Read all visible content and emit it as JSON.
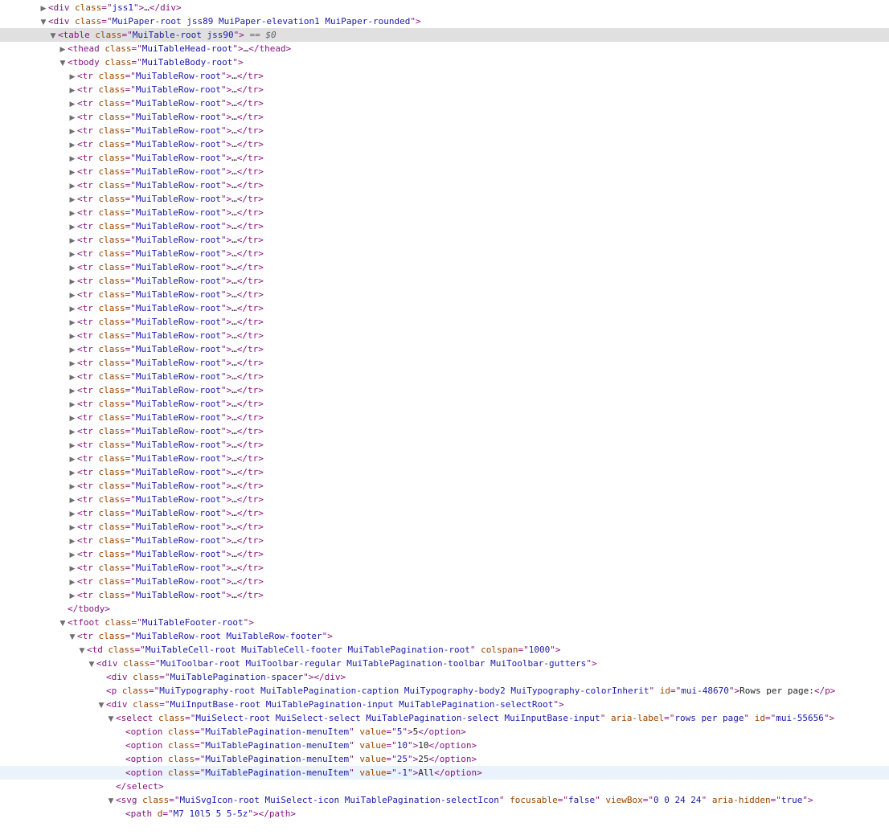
{
  "selected_marker": "== $0",
  "nodes": [
    {
      "depth": 0,
      "kind": "collapsed",
      "tag": "div",
      "attrs": [
        [
          "class",
          "jss1"
        ]
      ],
      "content": "…",
      "close": true
    },
    {
      "depth": 0,
      "kind": "expanded",
      "tag": "div",
      "attrs": [
        [
          "class",
          "MuiPaper-root jss89 MuiPaper-elevation1 MuiPaper-rounded"
        ]
      ]
    },
    {
      "depth": 1,
      "kind": "expanded",
      "tag": "table",
      "attrs": [
        [
          "class",
          "MuiTable-root jss90"
        ]
      ],
      "selected": true
    },
    {
      "depth": 2,
      "kind": "collapsed",
      "tag": "thead",
      "attrs": [
        [
          "class",
          "MuiTableHead-root"
        ]
      ],
      "content": "…",
      "close": true
    },
    {
      "depth": 2,
      "kind": "expanded",
      "tag": "tbody",
      "attrs": [
        [
          "class",
          "MuiTableBody-root"
        ]
      ]
    },
    {
      "depth": 3,
      "kind": "collapsed",
      "tag": "tr",
      "attrs": [
        [
          "class",
          "MuiTableRow-root"
        ]
      ],
      "content": "…",
      "close": true
    },
    {
      "depth": 3,
      "kind": "collapsed",
      "tag": "tr",
      "attrs": [
        [
          "class",
          "MuiTableRow-root"
        ]
      ],
      "content": "…",
      "close": true
    },
    {
      "depth": 3,
      "kind": "collapsed",
      "tag": "tr",
      "attrs": [
        [
          "class",
          "MuiTableRow-root"
        ]
      ],
      "content": "…",
      "close": true
    },
    {
      "depth": 3,
      "kind": "collapsed",
      "tag": "tr",
      "attrs": [
        [
          "class",
          "MuiTableRow-root"
        ]
      ],
      "content": "…",
      "close": true
    },
    {
      "depth": 3,
      "kind": "collapsed",
      "tag": "tr",
      "attrs": [
        [
          "class",
          "MuiTableRow-root"
        ]
      ],
      "content": "…",
      "close": true
    },
    {
      "depth": 3,
      "kind": "collapsed",
      "tag": "tr",
      "attrs": [
        [
          "class",
          "MuiTableRow-root"
        ]
      ],
      "content": "…",
      "close": true
    },
    {
      "depth": 3,
      "kind": "collapsed",
      "tag": "tr",
      "attrs": [
        [
          "class",
          "MuiTableRow-root"
        ]
      ],
      "content": "…",
      "close": true
    },
    {
      "depth": 3,
      "kind": "collapsed",
      "tag": "tr",
      "attrs": [
        [
          "class",
          "MuiTableRow-root"
        ]
      ],
      "content": "…",
      "close": true
    },
    {
      "depth": 3,
      "kind": "collapsed",
      "tag": "tr",
      "attrs": [
        [
          "class",
          "MuiTableRow-root"
        ]
      ],
      "content": "…",
      "close": true
    },
    {
      "depth": 3,
      "kind": "collapsed",
      "tag": "tr",
      "attrs": [
        [
          "class",
          "MuiTableRow-root"
        ]
      ],
      "content": "…",
      "close": true
    },
    {
      "depth": 3,
      "kind": "collapsed",
      "tag": "tr",
      "attrs": [
        [
          "class",
          "MuiTableRow-root"
        ]
      ],
      "content": "…",
      "close": true
    },
    {
      "depth": 3,
      "kind": "collapsed",
      "tag": "tr",
      "attrs": [
        [
          "class",
          "MuiTableRow-root"
        ]
      ],
      "content": "…",
      "close": true
    },
    {
      "depth": 3,
      "kind": "collapsed",
      "tag": "tr",
      "attrs": [
        [
          "class",
          "MuiTableRow-root"
        ]
      ],
      "content": "…",
      "close": true
    },
    {
      "depth": 3,
      "kind": "collapsed",
      "tag": "tr",
      "attrs": [
        [
          "class",
          "MuiTableRow-root"
        ]
      ],
      "content": "…",
      "close": true
    },
    {
      "depth": 3,
      "kind": "collapsed",
      "tag": "tr",
      "attrs": [
        [
          "class",
          "MuiTableRow-root"
        ]
      ],
      "content": "…",
      "close": true
    },
    {
      "depth": 3,
      "kind": "collapsed",
      "tag": "tr",
      "attrs": [
        [
          "class",
          "MuiTableRow-root"
        ]
      ],
      "content": "…",
      "close": true
    },
    {
      "depth": 3,
      "kind": "collapsed",
      "tag": "tr",
      "attrs": [
        [
          "class",
          "MuiTableRow-root"
        ]
      ],
      "content": "…",
      "close": true
    },
    {
      "depth": 3,
      "kind": "collapsed",
      "tag": "tr",
      "attrs": [
        [
          "class",
          "MuiTableRow-root"
        ]
      ],
      "content": "…",
      "close": true
    },
    {
      "depth": 3,
      "kind": "collapsed",
      "tag": "tr",
      "attrs": [
        [
          "class",
          "MuiTableRow-root"
        ]
      ],
      "content": "…",
      "close": true
    },
    {
      "depth": 3,
      "kind": "collapsed",
      "tag": "tr",
      "attrs": [
        [
          "class",
          "MuiTableRow-root"
        ]
      ],
      "content": "…",
      "close": true
    },
    {
      "depth": 3,
      "kind": "collapsed",
      "tag": "tr",
      "attrs": [
        [
          "class",
          "MuiTableRow-root"
        ]
      ],
      "content": "…",
      "close": true
    },
    {
      "depth": 3,
      "kind": "collapsed",
      "tag": "tr",
      "attrs": [
        [
          "class",
          "MuiTableRow-root"
        ]
      ],
      "content": "…",
      "close": true
    },
    {
      "depth": 3,
      "kind": "collapsed",
      "tag": "tr",
      "attrs": [
        [
          "class",
          "MuiTableRow-root"
        ]
      ],
      "content": "…",
      "close": true
    },
    {
      "depth": 3,
      "kind": "collapsed",
      "tag": "tr",
      "attrs": [
        [
          "class",
          "MuiTableRow-root"
        ]
      ],
      "content": "…",
      "close": true
    },
    {
      "depth": 3,
      "kind": "collapsed",
      "tag": "tr",
      "attrs": [
        [
          "class",
          "MuiTableRow-root"
        ]
      ],
      "content": "…",
      "close": true
    },
    {
      "depth": 3,
      "kind": "collapsed",
      "tag": "tr",
      "attrs": [
        [
          "class",
          "MuiTableRow-root"
        ]
      ],
      "content": "…",
      "close": true
    },
    {
      "depth": 3,
      "kind": "collapsed",
      "tag": "tr",
      "attrs": [
        [
          "class",
          "MuiTableRow-root"
        ]
      ],
      "content": "…",
      "close": true
    },
    {
      "depth": 3,
      "kind": "collapsed",
      "tag": "tr",
      "attrs": [
        [
          "class",
          "MuiTableRow-root"
        ]
      ],
      "content": "…",
      "close": true
    },
    {
      "depth": 3,
      "kind": "collapsed",
      "tag": "tr",
      "attrs": [
        [
          "class",
          "MuiTableRow-root"
        ]
      ],
      "content": "…",
      "close": true
    },
    {
      "depth": 3,
      "kind": "collapsed",
      "tag": "tr",
      "attrs": [
        [
          "class",
          "MuiTableRow-root"
        ]
      ],
      "content": "…",
      "close": true
    },
    {
      "depth": 3,
      "kind": "collapsed",
      "tag": "tr",
      "attrs": [
        [
          "class",
          "MuiTableRow-root"
        ]
      ],
      "content": "…",
      "close": true
    },
    {
      "depth": 3,
      "kind": "collapsed",
      "tag": "tr",
      "attrs": [
        [
          "class",
          "MuiTableRow-root"
        ]
      ],
      "content": "…",
      "close": true
    },
    {
      "depth": 3,
      "kind": "collapsed",
      "tag": "tr",
      "attrs": [
        [
          "class",
          "MuiTableRow-root"
        ]
      ],
      "content": "…",
      "close": true
    },
    {
      "depth": 3,
      "kind": "collapsed",
      "tag": "tr",
      "attrs": [
        [
          "class",
          "MuiTableRow-root"
        ]
      ],
      "content": "…",
      "close": true
    },
    {
      "depth": 3,
      "kind": "collapsed",
      "tag": "tr",
      "attrs": [
        [
          "class",
          "MuiTableRow-root"
        ]
      ],
      "content": "…",
      "close": true
    },
    {
      "depth": 3,
      "kind": "collapsed",
      "tag": "tr",
      "attrs": [
        [
          "class",
          "MuiTableRow-root"
        ]
      ],
      "content": "…",
      "close": true
    },
    {
      "depth": 3,
      "kind": "collapsed",
      "tag": "tr",
      "attrs": [
        [
          "class",
          "MuiTableRow-root"
        ]
      ],
      "content": "…",
      "close": true
    },
    {
      "depth": 3,
      "kind": "collapsed",
      "tag": "tr",
      "attrs": [
        [
          "class",
          "MuiTableRow-root"
        ]
      ],
      "content": "…",
      "close": true
    },
    {
      "depth": 3,
      "kind": "collapsed",
      "tag": "tr",
      "attrs": [
        [
          "class",
          "MuiTableRow-root"
        ]
      ],
      "content": "…",
      "close": true
    },
    {
      "depth": 2,
      "kind": "close",
      "tag": "tbody"
    },
    {
      "depth": 2,
      "kind": "expanded",
      "tag": "tfoot",
      "attrs": [
        [
          "class",
          "MuiTableFooter-root"
        ]
      ]
    },
    {
      "depth": 3,
      "kind": "expanded",
      "tag": "tr",
      "attrs": [
        [
          "class",
          "MuiTableRow-root MuiTableRow-footer"
        ]
      ]
    },
    {
      "depth": 4,
      "kind": "expanded",
      "tag": "td",
      "attrs": [
        [
          "class",
          "MuiTableCell-root MuiTableCell-footer MuiTablePagination-root"
        ],
        [
          "colspan",
          "1000"
        ]
      ]
    },
    {
      "depth": 5,
      "kind": "expanded",
      "tag": "div",
      "attrs": [
        [
          "class",
          "MuiToolbar-root MuiToolbar-regular MuiTablePagination-toolbar MuiToolbar-gutters"
        ]
      ]
    },
    {
      "depth": 6,
      "kind": "leaf",
      "tag": "div",
      "attrs": [
        [
          "class",
          "MuiTablePagination-spacer"
        ]
      ],
      "content": "",
      "close": true
    },
    {
      "depth": 6,
      "kind": "leaf",
      "tag": "p",
      "attrs": [
        [
          "class",
          "MuiTypography-root MuiTablePagination-caption MuiTypography-body2 MuiTypography-colorInherit"
        ],
        [
          "id",
          "mui-48670"
        ]
      ],
      "content": "Rows per page:",
      "close": true
    },
    {
      "depth": 6,
      "kind": "expanded",
      "tag": "div",
      "attrs": [
        [
          "class",
          "MuiInputBase-root MuiTablePagination-input MuiTablePagination-selectRoot"
        ]
      ]
    },
    {
      "depth": 7,
      "kind": "expanded",
      "tag": "select",
      "attrs": [
        [
          "class",
          "MuiSelect-root MuiSelect-select MuiTablePagination-select MuiInputBase-input"
        ],
        [
          "aria-label",
          "rows per page"
        ],
        [
          "id",
          "mui-55656"
        ]
      ]
    },
    {
      "depth": 8,
      "kind": "leaf",
      "tag": "option",
      "attrs": [
        [
          "class",
          "MuiTablePagination-menuItem"
        ],
        [
          "value",
          "5"
        ]
      ],
      "content": "5",
      "close": true
    },
    {
      "depth": 8,
      "kind": "leaf",
      "tag": "option",
      "attrs": [
        [
          "class",
          "MuiTablePagination-menuItem"
        ],
        [
          "value",
          "10"
        ]
      ],
      "content": "10",
      "close": true
    },
    {
      "depth": 8,
      "kind": "leaf",
      "tag": "option",
      "attrs": [
        [
          "class",
          "MuiTablePagination-menuItem"
        ],
        [
          "value",
          "25"
        ]
      ],
      "content": "25",
      "close": true
    },
    {
      "depth": 8,
      "kind": "leaf",
      "tag": "option",
      "attrs": [
        [
          "class",
          "MuiTablePagination-menuItem"
        ],
        [
          "value",
          "-1"
        ]
      ],
      "content": "All",
      "close": true,
      "hovered": true
    },
    {
      "depth": 7,
      "kind": "close",
      "tag": "select"
    },
    {
      "depth": 7,
      "kind": "expanded",
      "tag": "svg",
      "attrs": [
        [
          "class",
          "MuiSvgIcon-root MuiSelect-icon MuiTablePagination-selectIcon"
        ],
        [
          "focusable",
          "false"
        ],
        [
          "viewBox",
          "0 0 24 24"
        ],
        [
          "aria-hidden",
          "true"
        ]
      ]
    },
    {
      "depth": 8,
      "kind": "leaf",
      "tag": "path",
      "attrs": [
        [
          "d",
          "M7 10l5 5 5-5z"
        ]
      ],
      "content": "",
      "close": true
    }
  ]
}
